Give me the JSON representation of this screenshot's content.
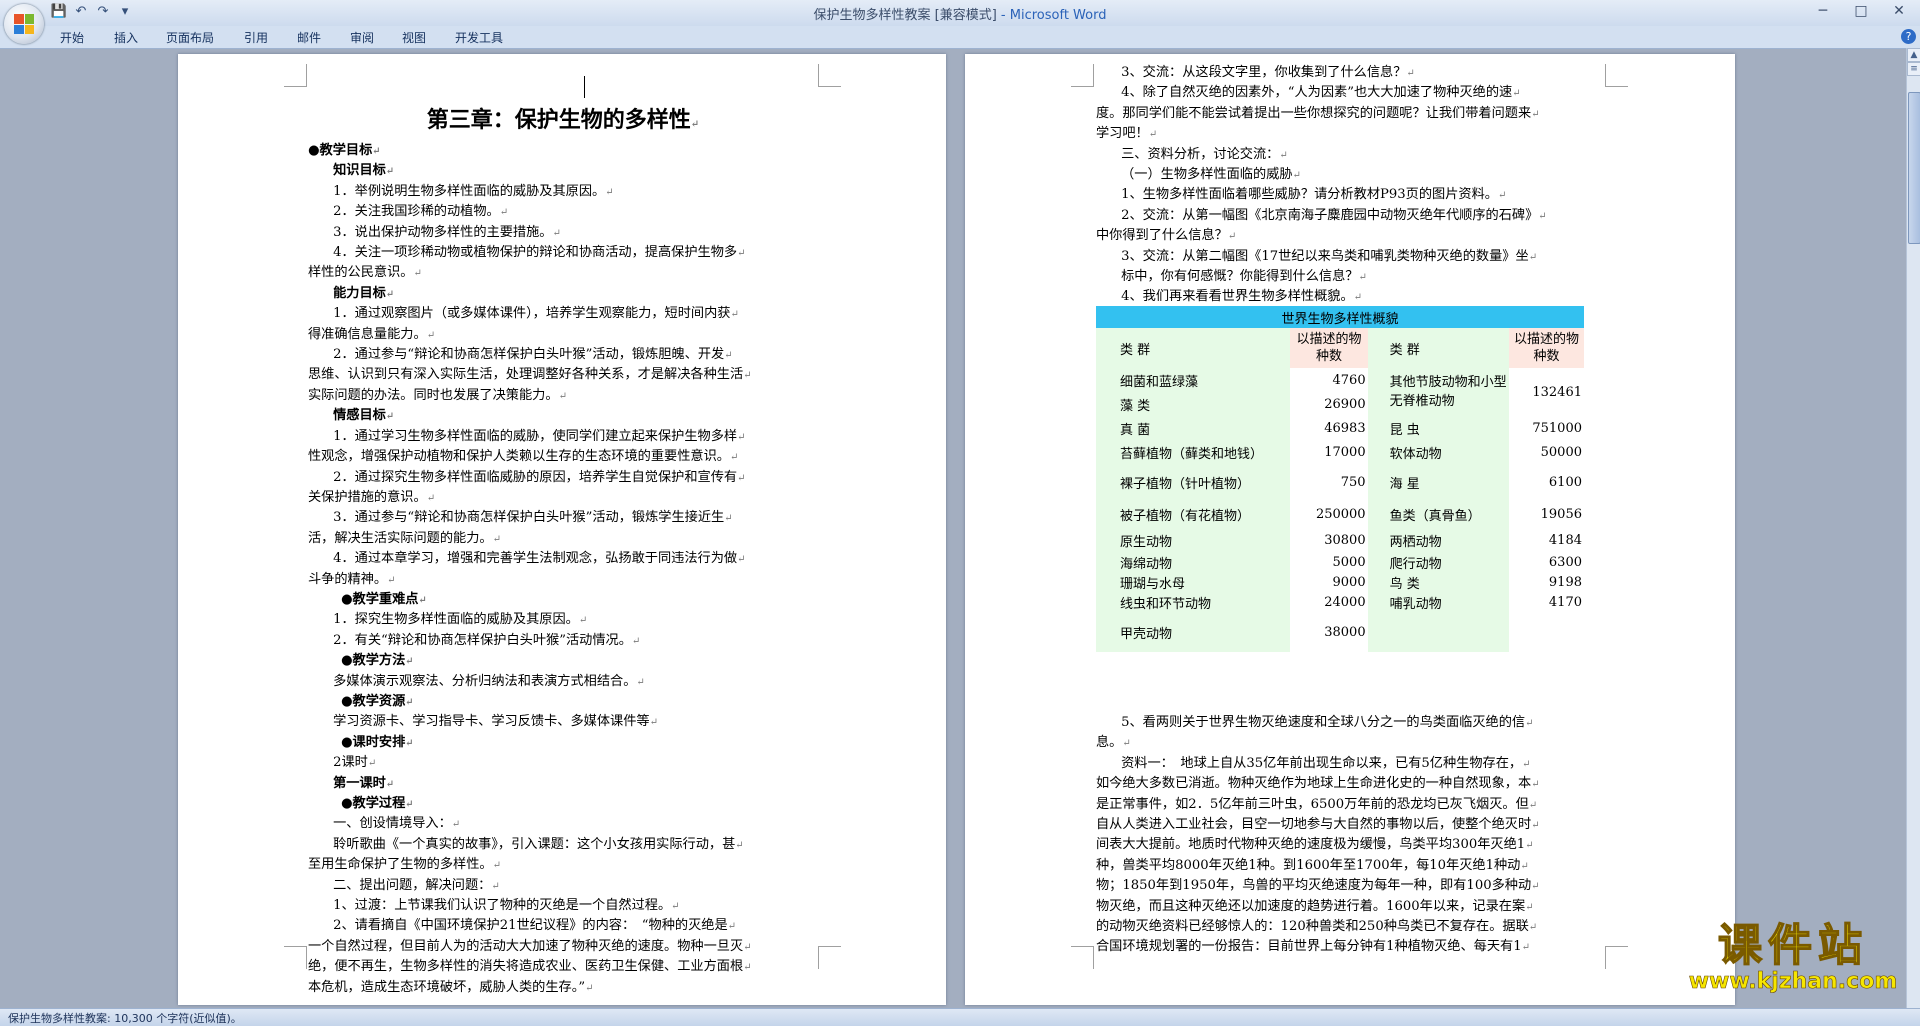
{
  "window": {
    "title": "保护生物多样性教案 [兼容模式]",
    "app_name": " - Microsoft Word",
    "help": "?"
  },
  "qat": {
    "save": "💾",
    "undo": "↶",
    "redo": "↷",
    "more": "▾"
  },
  "window_controls": {
    "minimize": "─",
    "maximize": "□",
    "close": "✕"
  },
  "tabs": [
    "开始",
    "插入",
    "页面布局",
    "引用",
    "邮件",
    "审阅",
    "视图",
    "开发工具"
  ],
  "page1": {
    "chapter_title": "第三章：保护生物的多样性",
    "lines": [
      {
        "t": "●教学目标",
        "cls": "b",
        "ind": 0
      },
      {
        "t": "知识目标",
        "cls": "b",
        "ind": 1
      },
      {
        "t": "1．举例说明生物多样性面临的威胁及其原因。",
        "ind": 1
      },
      {
        "t": "2．关注我国珍稀的动植物。",
        "ind": 1
      },
      {
        "t": "3．说出保护动物多样性的主要措施。",
        "ind": 1
      },
      {
        "t": "4．关注一项珍稀动物或植物保护的辩论和协商活动，提高保护生物多",
        "ind": 1
      },
      {
        "t": "样性的公民意识。",
        "ind": 0
      },
      {
        "t": "能力目标",
        "cls": "b",
        "ind": 1
      },
      {
        "t": "1．通过观察图片（或多媒体课件），培养学生观察能力，短时间内获",
        "ind": 1
      },
      {
        "t": "得准确信息量能力。",
        "ind": 0
      },
      {
        "t": "2．通过参与“辩论和协商怎样保护白头叶猴”活动，锻炼胆魄、开发",
        "ind": 1
      },
      {
        "t": "思维、认识到只有深入实际生活，处理调整好各种关系，才是解决各种生活",
        "ind": 0
      },
      {
        "t": "实际问题的办法。同时也发展了决策能力。",
        "ind": 0
      },
      {
        "t": "情感目标",
        "cls": "b",
        "ind": 1
      },
      {
        "t": "1．通过学习生物多样性面临的威胁，使同学们建立起来保护生物多样",
        "ind": 1
      },
      {
        "t": "性观念，增强保护动植物和保护人类赖以生存的生态环境的重要性意识。",
        "ind": 0
      },
      {
        "t": "2．通过探究生物多样性面临威胁的原因，培养学生自觉保护和宣传有",
        "ind": 1
      },
      {
        "t": "关保护措施的意识。",
        "ind": 0
      },
      {
        "t": "3．通过参与“辩论和协商怎样保护白头叶猴”活动，锻炼学生接近生",
        "ind": 1
      },
      {
        "t": "活，解决生活实际问题的能力。",
        "ind": 0
      },
      {
        "t": "4．通过本章学习，增强和完善学生法制观念，弘扬敢于同违法行为做",
        "ind": 1
      },
      {
        "t": "斗争的精神。",
        "ind": 0
      },
      {
        "t": "●教学重难点",
        "cls": "b",
        "ind": 2
      },
      {
        "t": "1．探究生物多样性面临的威胁及其原因。",
        "ind": 1
      },
      {
        "t": "2．有关“辩论和协商怎样保护白头叶猴”活动情况。",
        "ind": 1
      },
      {
        "t": "●教学方法",
        "cls": "b",
        "ind": 2
      },
      {
        "t": "多媒体演示观察法、分析归纳法和表演方式相结合。",
        "ind": 1
      },
      {
        "t": "●教学资源",
        "cls": "b",
        "ind": 2
      },
      {
        "t": "学习资源卡、学习指导卡、学习反馈卡、多媒体课件等",
        "ind": 1
      },
      {
        "t": "●课时安排",
        "cls": "b",
        "ind": 2
      },
      {
        "t": "2课时",
        "ind": 1
      },
      {
        "t": "第一课时",
        "cls": "b",
        "ind": 1
      },
      {
        "t": "●教学过程",
        "cls": "b",
        "ind": 2
      },
      {
        "t": "一、创设情境导入：",
        "ind": 1
      },
      {
        "t": "聆听歌曲《一个真实的故事》，引入课题：这个小女孩用实际行动，甚",
        "ind": 1
      },
      {
        "t": "至用生命保护了生物的多样性。",
        "ind": 0
      },
      {
        "t": "二、提出问题，解决问题：",
        "ind": 1
      },
      {
        "t": "1、过渡：上节课我们认识了物种的灭绝是一个自然过程。",
        "ind": 1
      },
      {
        "t": "2、请看摘自《中国环境保护21世纪议程》的内容：　“物种的灭绝是",
        "ind": 1
      },
      {
        "t": "一个自然过程，但目前人为的活动大大加速了物种灭绝的速度。物种一旦灭",
        "ind": 0
      },
      {
        "t": "绝，便不再生，生物多样性的消失将造成农业、医药卫生保健、工业方面根",
        "ind": 0
      },
      {
        "t": "本危机，造成生态环境破坏，威胁人类的生存。”",
        "ind": 0
      }
    ]
  },
  "page2": {
    "top_lines": [
      {
        "t": "3、交流：从这段文字里，你收集到了什么信息？",
        "ind": 1
      },
      {
        "t": "4、除了自然灭绝的因素外，“人为因素”也大大加速了物种灭绝的速",
        "ind": 1
      },
      {
        "t": "度。那同学们能不能尝试着提出一些你想探究的问题呢？让我们带着问题来",
        "ind": 0
      },
      {
        "t": "学习吧！",
        "ind": 0
      },
      {
        "t": "三、资料分析，讨论交流：",
        "ind": 1
      },
      {
        "t": "（一）生物多样性面临的威胁",
        "ind": 1
      },
      {
        "t": "1、生物多样性面临着哪些威胁？请分析教材P93页的图片资料。",
        "ind": 1
      },
      {
        "t": "2、交流：从第一幅图《北京南海子麋鹿园中动物灭绝年代顺序的石碑》",
        "ind": 1
      },
      {
        "t": "中你得到了什么信息？",
        "ind": 0
      },
      {
        "t": "3、交流：从第二幅图《17世纪以来鸟类和哺乳类物种灭绝的数量》坐",
        "ind": 1
      },
      {
        "t": "标中，你有何感慨？你能得到什么信息？",
        "ind": 1
      },
      {
        "t": "4、我们再来看看世界生物多样性概貌。",
        "ind": 1
      }
    ],
    "table": {
      "caption": "世界生物多样性概貌",
      "header_group": "类 群",
      "header_count": "以描述的物种数",
      "rows": [
        {
          "a": "细菌和蓝绿藻",
          "an": "4760",
          "b": "其他节肢动物和小型无脊椎动物",
          "bn": "132461"
        },
        {
          "a": "藻 类",
          "an": "26900",
          "b": "",
          "bn": ""
        },
        {
          "a": "真 菌",
          "an": "46983",
          "b": "昆 虫",
          "bn": "751000"
        },
        {
          "a": "苔藓植物（藓类和地钱）",
          "an": "17000",
          "b": "软体动物",
          "bn": "50000"
        },
        {
          "a": "裸子植物（针叶植物）",
          "an": "750",
          "b": "海 星",
          "bn": "6100"
        },
        {
          "a": "被子植物（有花植物）",
          "an": "250000",
          "b": "鱼类（真骨鱼）",
          "bn": "19056"
        },
        {
          "a": "原生动物",
          "an": "30800",
          "b": "两栖动物",
          "bn": "4184"
        },
        {
          "a": "海绵动物",
          "an": "5000",
          "b": "爬行动物",
          "bn": "6300"
        },
        {
          "a": "珊瑚与水母",
          "an": "9000",
          "b": "鸟 类",
          "bn": "9198"
        },
        {
          "a": "线虫和环节动物",
          "an": "24000",
          "b": "哺乳动物",
          "bn": "4170"
        },
        {
          "a": "甲壳动物",
          "an": "38000",
          "b": "",
          "bn": ""
        }
      ]
    },
    "bottom_lines": [
      {
        "t": "5、看两则关于世界生物灭绝速度和全球八分之一的鸟类面临灭绝的信",
        "ind": 1
      },
      {
        "t": "息。",
        "ind": 0
      },
      {
        "t": "资料一：　地球上自从35亿年前出现生命以来，已有5亿种生物存在，",
        "ind": 1
      },
      {
        "t": "如今绝大多数已消逝。物种灭绝作为地球上生命进化史的一种自然现象，本",
        "ind": 0
      },
      {
        "t": "是正常事件，如2．5亿年前三叶虫，6500万年前的恐龙均已灰飞烟灭。但",
        "ind": 0
      },
      {
        "t": "自从人类进入工业社会，目空一切地参与大自然的事物以后，使整个绝灭时",
        "ind": 0
      },
      {
        "t": "间表大大提前。地质时代物种灭绝的速度极为缓慢，鸟类平均300年灭绝1",
        "ind": 0
      },
      {
        "t": "种，兽类平均8000年灭绝1种。到1600年至1700年，每10年灭绝1种动",
        "ind": 0
      },
      {
        "t": "物；1850年到1950年，鸟兽的平均灭绝速度为每年一种，即有100多种动",
        "ind": 0
      },
      {
        "t": "物灭绝，而且这种灭绝还以加速度的趋势进行着。1600年以来，记录在案",
        "ind": 0
      },
      {
        "t": "的动物灭绝资料已经够惊人的：120种兽类和250种鸟类已不复存在。据联",
        "ind": 0
      },
      {
        "t": "合国环境规划署的一份报告：目前世界上每分钟有1种植物灭绝、每天有1",
        "ind": 0
      }
    ]
  },
  "status": {
    "text": "保护生物多样性教案: 10,300 个字符(近似值)。"
  },
  "watermark": {
    "cn": "课件站",
    "url": "www.kjzhan.com"
  },
  "colors": {
    "table_caption": "#33c1f0",
    "table_green": "#e6fae6",
    "table_pink": "#fde7e0",
    "watermark": "#f6e600"
  }
}
